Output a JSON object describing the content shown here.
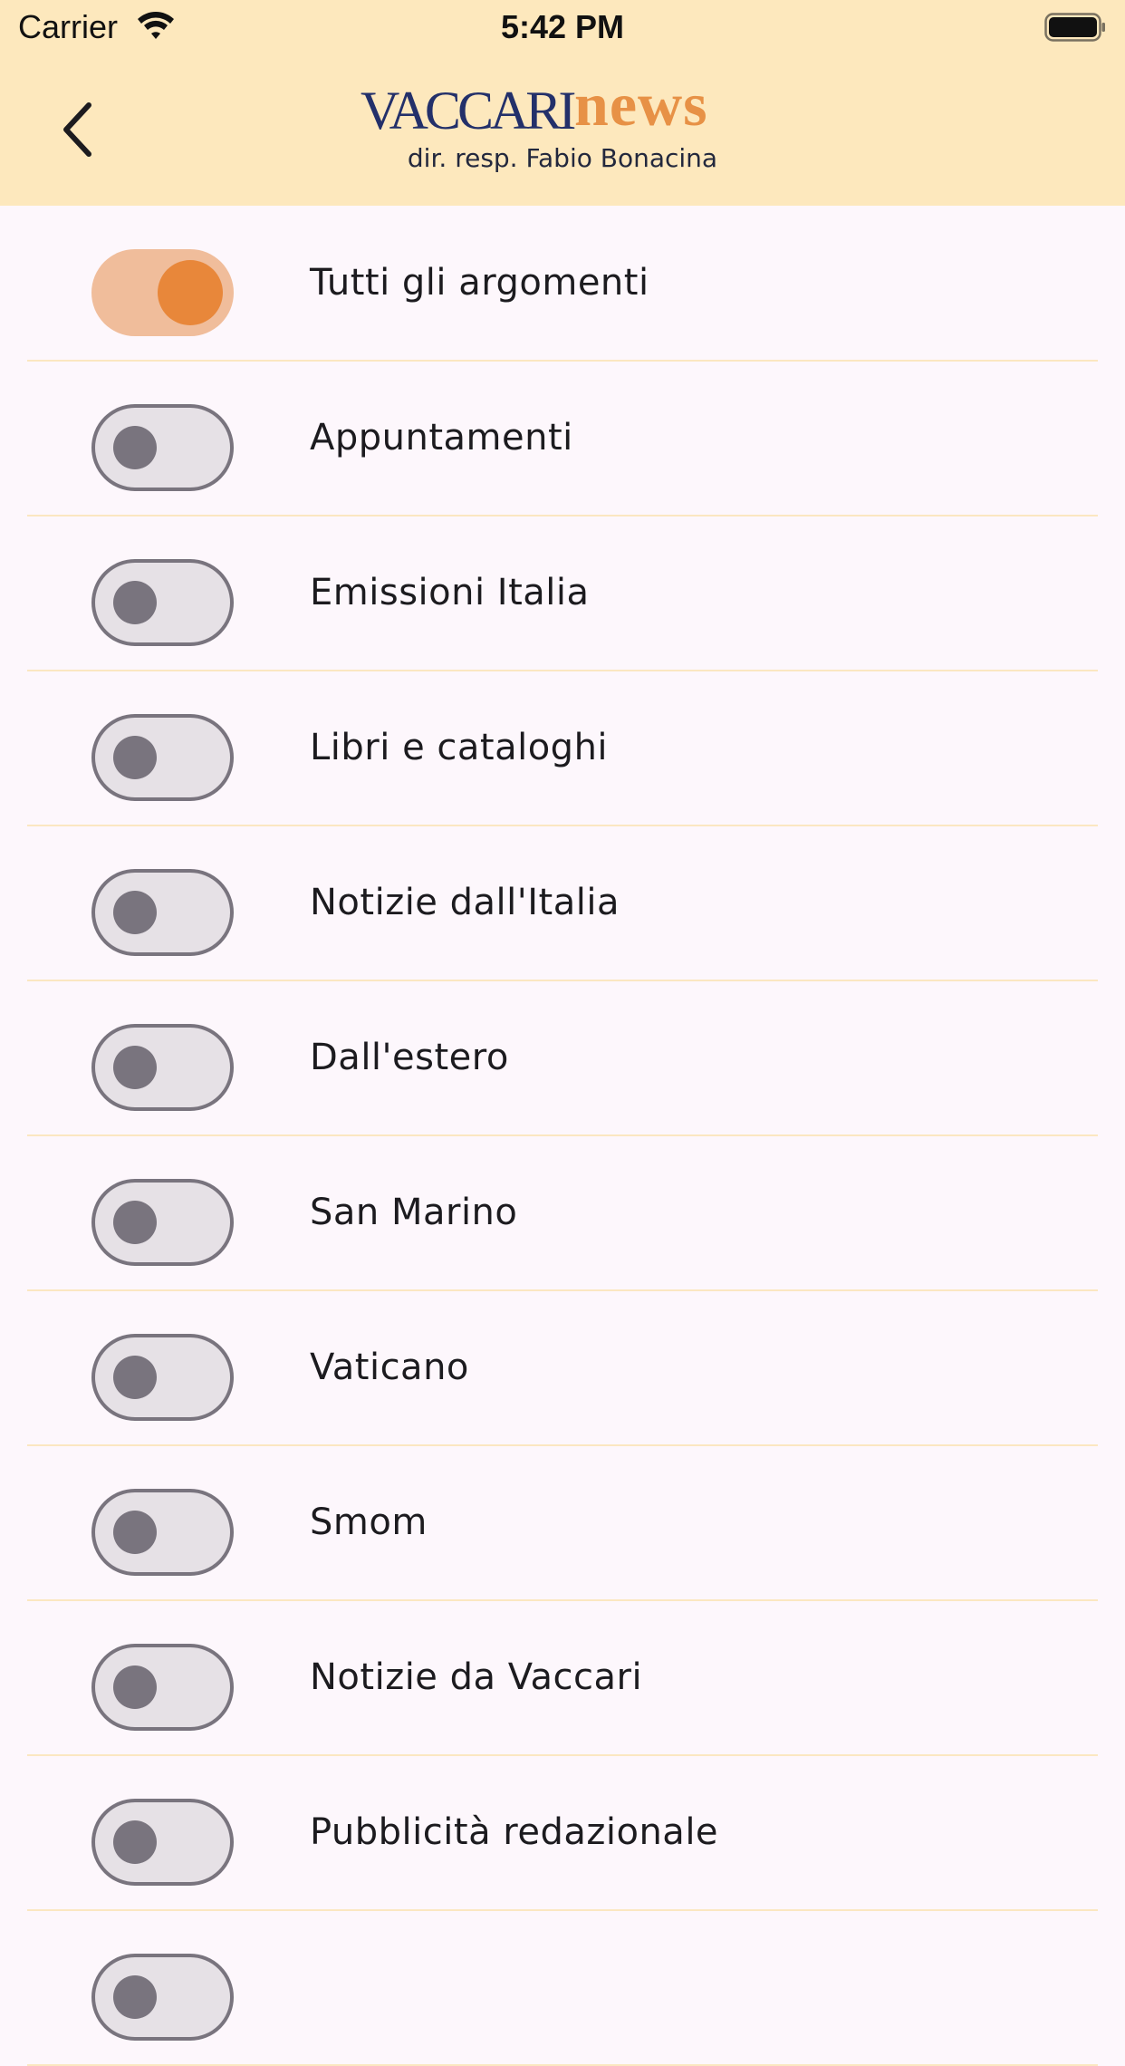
{
  "status_bar": {
    "carrier": "Carrier",
    "time": "5:42 PM"
  },
  "header": {
    "back_icon": "chevron-left-icon",
    "logo_part1": "VACCARI",
    "logo_part2": "news",
    "subtitle": "dir. resp. Fabio Bonacina"
  },
  "colors": {
    "header_bg": "#fde8bd",
    "page_bg": "#fdf7fc",
    "accent": "#e8873a",
    "switch_on_track": "#f0bd9b",
    "switch_off_track": "#e6e1e6",
    "switch_off_thumb": "#79747e",
    "divider": "#fbe7c1",
    "logo_blue": "#23306a",
    "logo_orange": "#e68a3c"
  },
  "topics": [
    {
      "label": "Tutti gli argomenti",
      "on": true
    },
    {
      "label": "Appuntamenti",
      "on": false
    },
    {
      "label": "Emissioni Italia",
      "on": false
    },
    {
      "label": "Libri e cataloghi",
      "on": false
    },
    {
      "label": "Notizie dall'Italia",
      "on": false
    },
    {
      "label": "Dall'estero",
      "on": false
    },
    {
      "label": "San Marino",
      "on": false
    },
    {
      "label": "Vaticano",
      "on": false
    },
    {
      "label": "Smom",
      "on": false
    },
    {
      "label": "Notizie da Vaccari",
      "on": false
    },
    {
      "label": "Pubblicità redazionale",
      "on": false
    },
    {
      "label": "",
      "on": false
    }
  ]
}
